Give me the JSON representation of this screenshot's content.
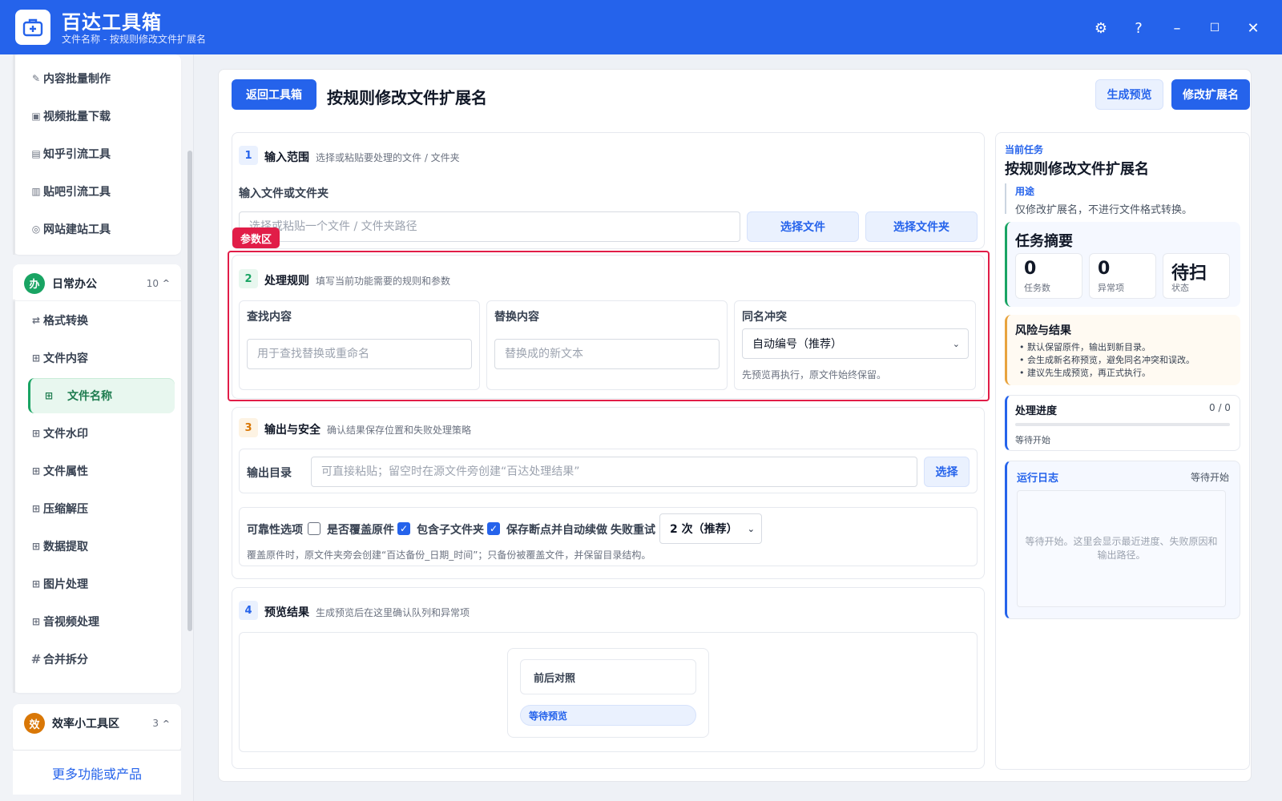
{
  "app": {
    "title": "百达工具箱",
    "subtitle": "文件名称 - 按规则修改文件扩展名"
  },
  "window_controls": {
    "settings": "⚙",
    "help": "?",
    "minimize": "–",
    "maximize": "☐",
    "close": "✕"
  },
  "sidebar": {
    "top_items": [
      {
        "label": "内容批量制作",
        "icon": "pen-icon"
      },
      {
        "label": "视频批量下载",
        "icon": "video-icon"
      },
      {
        "label": "知乎引流工具",
        "icon": "zhihu-icon"
      },
      {
        "label": "贴吧引流工具",
        "icon": "tieba-icon"
      },
      {
        "label": "网站建站工具",
        "icon": "globe-icon"
      }
    ],
    "group_office": {
      "badge": "办",
      "label": "日常办公",
      "count": "10",
      "caret": "^"
    },
    "office_items": [
      {
        "label": "格式转换",
        "icon": "swap-icon"
      },
      {
        "label": "文件内容",
        "icon": "grid-icon"
      },
      {
        "label": "文件名称",
        "icon": "grid-icon"
      },
      {
        "label": "文件水印",
        "icon": "grid-icon"
      },
      {
        "label": "文件属性",
        "icon": "grid-icon"
      },
      {
        "label": "压缩解压",
        "icon": "grid-icon"
      },
      {
        "label": "数据提取",
        "icon": "grid-icon"
      },
      {
        "label": "图片处理",
        "icon": "grid-icon"
      },
      {
        "label": "音视频处理",
        "icon": "grid-icon"
      },
      {
        "label": "合并拆分",
        "icon": "hash-icon"
      }
    ],
    "group_tools": {
      "badge": "效",
      "label": "效率小工具区",
      "count": "3",
      "caret": "^"
    },
    "more": "更多功能或产品"
  },
  "header": {
    "back": "返回工具箱",
    "title": "按规则修改文件扩展名",
    "preview": "生成预览",
    "run": "修改扩展名"
  },
  "sec1": {
    "step": "1",
    "title": "输入范围",
    "desc": "选择或粘贴要处理的文件 / 文件夹",
    "label": "输入文件或文件夹",
    "placeholder": "选择或粘贴一个文件 / 文件夹路径",
    "btn_file": "选择文件",
    "btn_folder": "选择文件夹"
  },
  "tag": "参数区",
  "sec2": {
    "step": "2",
    "title": "处理规则",
    "desc": "填写当前功能需要的规则和参数",
    "find_label": "查找内容",
    "find_placeholder": "用于查找替换或重命名",
    "replace_label": "替换内容",
    "replace_placeholder": "替换成的新文本",
    "conflict_label": "同名冲突",
    "conflict_value": "自动编号（推荐）",
    "conflict_hint": "先预览再执行，原文件始终保留。"
  },
  "sec3": {
    "step": "3",
    "title": "输出与安全",
    "desc": "确认结果保存位置和失败处理策略",
    "out_label": "输出目录",
    "out_placeholder": "可直接粘贴；留空时在源文件旁创建“百达处理结果”",
    "out_btn": "选择",
    "rel_label": "可靠性选项",
    "opt_overwrite": "是否覆盖原件",
    "opt_sub": "包含子文件夹",
    "opt_resume": "保存断点并自动续做",
    "retry_label": "失败重试",
    "retry_value": "2 次（推荐）",
    "hint": "覆盖原件时，原文件夹旁会创建“百达备份_日期_时间”；只备份被覆盖文件，并保留目录结构。"
  },
  "sec4": {
    "step": "4",
    "title": "预览结果",
    "desc": "生成预览后在这里确认队列和异常项",
    "compare": "前后对照",
    "status": "等待预览"
  },
  "right": {
    "kicker": "当前任务",
    "title": "按规则修改文件扩展名",
    "use_label": "用途",
    "use_text": "仅修改扩展名，不进行文件格式转换。",
    "summary_title": "任务摘要",
    "stats": [
      {
        "num": "0",
        "cap": "任务数"
      },
      {
        "num": "0",
        "cap": "异常项"
      },
      {
        "num": "待扫",
        "cap": "状态"
      }
    ],
    "risk_title": "风险与结果",
    "risks": [
      "默认保留原件，输出到新目录。",
      "会生成新名称预览，避免同名冲突和误改。",
      "建议先生成预览，再正式执行。"
    ],
    "progress_title": "处理进度",
    "progress_count": "0 / 0",
    "progress_value": 0,
    "progress_status": "等待开始",
    "log_title": "运行日志",
    "log_status": "等待开始",
    "log_body": "等待开始。这里会显示最近进度、失败原因和输出路径。"
  },
  "colors": {
    "brand": "#2563eb",
    "green": "#19a463",
    "orange": "#e8a33d",
    "red": "#e11d48"
  }
}
